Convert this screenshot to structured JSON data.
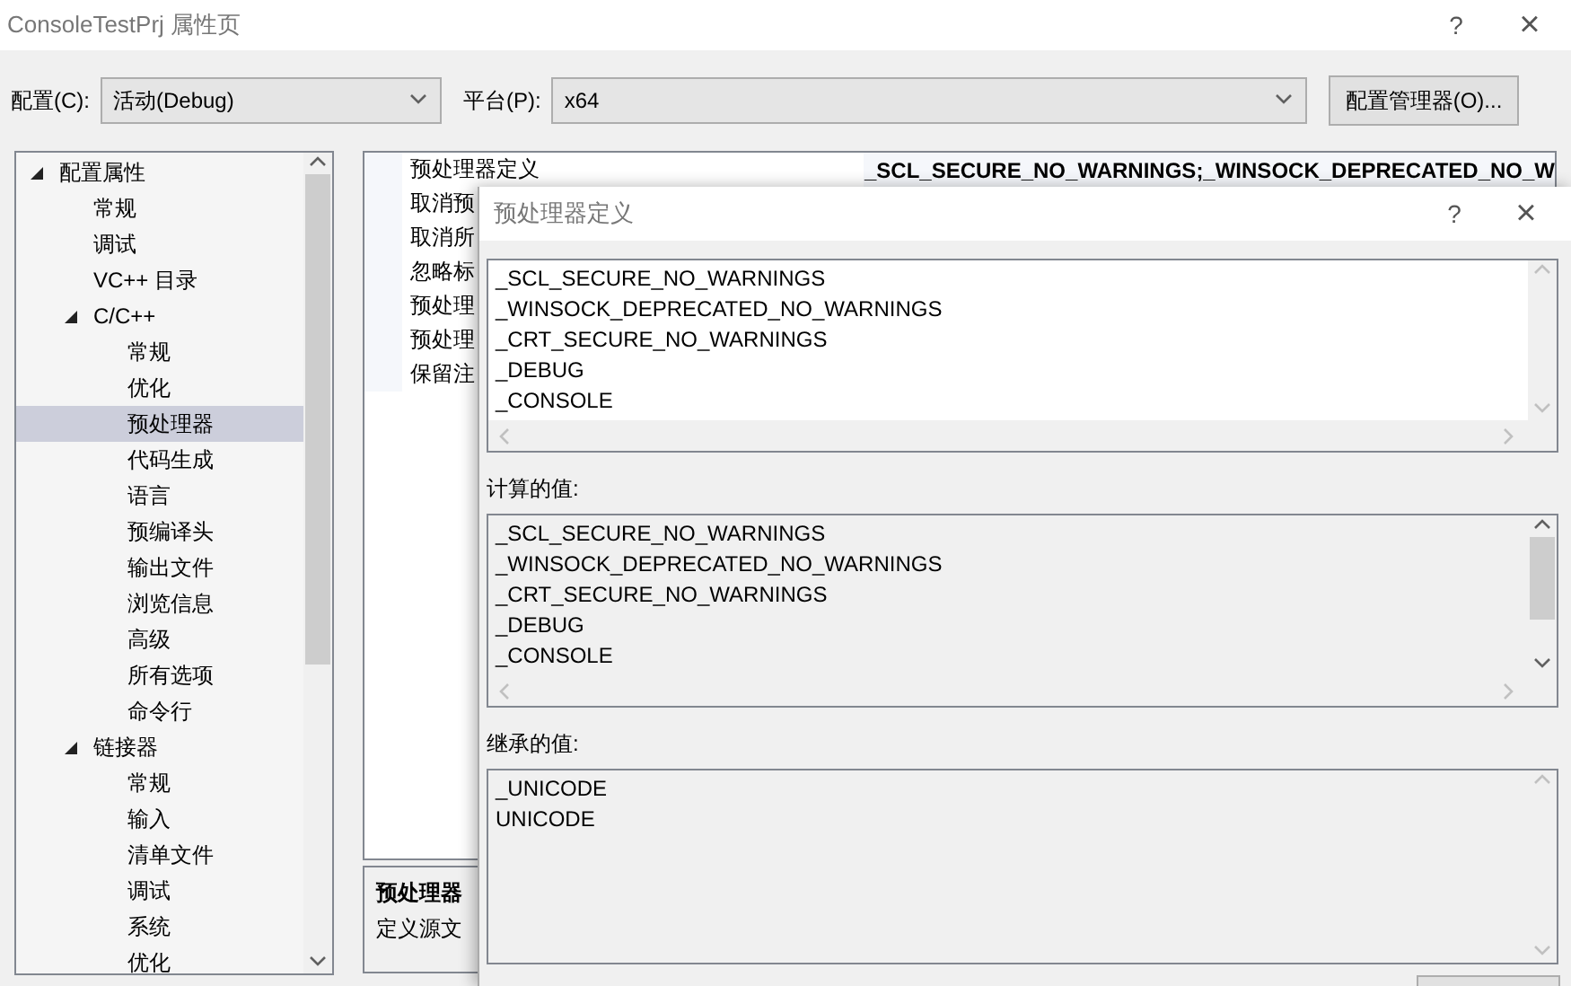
{
  "window": {
    "title": "ConsoleTestPrj 属性页",
    "help": "?",
    "close": "×"
  },
  "config": {
    "label": "配置(C):",
    "value": "活动(Debug)"
  },
  "platform": {
    "label": "平台(P):",
    "value": "x64"
  },
  "manager_button": "配置管理器(O)...",
  "tree": [
    {
      "label": "配置属性",
      "expanded": true,
      "selected": false,
      "children": [
        {
          "label": "常规",
          "selected": false
        },
        {
          "label": "调试",
          "selected": false
        },
        {
          "label": "VC++ 目录",
          "selected": false
        },
        {
          "label": "C/C++",
          "expanded": true,
          "selected": false,
          "children": [
            {
              "label": "常规",
              "selected": false
            },
            {
              "label": "优化",
              "selected": false
            },
            {
              "label": "预处理器",
              "selected": true
            },
            {
              "label": "代码生成",
              "selected": false
            },
            {
              "label": "语言",
              "selected": false
            },
            {
              "label": "预编译头",
              "selected": false
            },
            {
              "label": "输出文件",
              "selected": false
            },
            {
              "label": "浏览信息",
              "selected": false
            },
            {
              "label": "高级",
              "selected": false
            },
            {
              "label": "所有选项",
              "selected": false
            },
            {
              "label": "命令行",
              "selected": false
            }
          ]
        },
        {
          "label": "链接器",
          "expanded": true,
          "selected": false,
          "children": [
            {
              "label": "常规",
              "selected": false
            },
            {
              "label": "输入",
              "selected": false
            },
            {
              "label": "清单文件",
              "selected": false
            },
            {
              "label": "调试",
              "selected": false
            },
            {
              "label": "系统",
              "selected": false
            },
            {
              "label": "优化",
              "selected": false
            }
          ]
        }
      ]
    }
  ],
  "properties": [
    {
      "label": "预处理器定义",
      "value": "_SCL_SECURE_NO_WARNINGS;_WINSOCK_DEPRECATED_NO_W"
    },
    {
      "label": "取消预"
    },
    {
      "label": "取消所"
    },
    {
      "label": "忽略标"
    },
    {
      "label": "预处理"
    },
    {
      "label": "预处理"
    },
    {
      "label": "保留注"
    }
  ],
  "description": {
    "title": "预处理器",
    "text": "定义源文"
  },
  "dialog": {
    "title": "预处理器定义",
    "help": "?",
    "close": "×",
    "definitions": [
      "_SCL_SECURE_NO_WARNINGS",
      "_WINSOCK_DEPRECATED_NO_WARNINGS",
      "_CRT_SECURE_NO_WARNINGS",
      "_DEBUG",
      "_CONSOLE"
    ],
    "computed_label": "计算的值:",
    "computed": [
      "_SCL_SECURE_NO_WARNINGS",
      "_WINSOCK_DEPRECATED_NO_WARNINGS",
      "_CRT_SECURE_NO_WARNINGS",
      "_DEBUG",
      "_CONSOLE"
    ],
    "inherited_label": "继承的值:",
    "inherited": [
      "_UNICODE",
      "UNICODE"
    ]
  }
}
